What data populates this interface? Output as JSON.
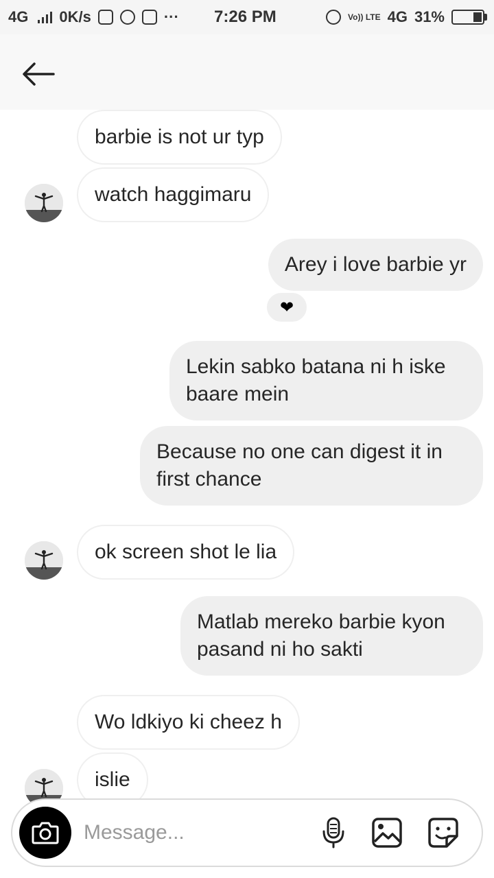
{
  "status_bar": {
    "network": "4G",
    "speed": "0K/s",
    "more": "···",
    "time": "7:26 PM",
    "volte": "Vo)) LTE",
    "network2": "4G",
    "battery": "31%",
    "battery_level": 0.31
  },
  "messages": [
    {
      "dir": "in",
      "text": "barbie is not ur typ"
    },
    {
      "dir": "in",
      "text": "watch haggimaru"
    },
    {
      "dir": "out",
      "text": "Arey i love barbie yr"
    },
    {
      "dir": "out",
      "text": "Lekin sabko batana ni h iske baare mein"
    },
    {
      "dir": "out",
      "text": "Because no one can digest it in first chance"
    },
    {
      "dir": "in",
      "text": "ok screen shot le lia"
    },
    {
      "dir": "out",
      "text": "Matlab mereko barbie kyon pasand ni ho sakti"
    },
    {
      "dir": "in",
      "text": "Wo ldkiyo ki cheez h"
    },
    {
      "dir": "in",
      "text": "islie"
    }
  ],
  "reaction": {
    "icon": "heart",
    "glyph": "❤"
  },
  "composer": {
    "placeholder": "Message..."
  },
  "colors": {
    "outgoing_bubble": "#efefef",
    "incoming_border": "#efefef",
    "header_bg": "#f8f8f8"
  }
}
